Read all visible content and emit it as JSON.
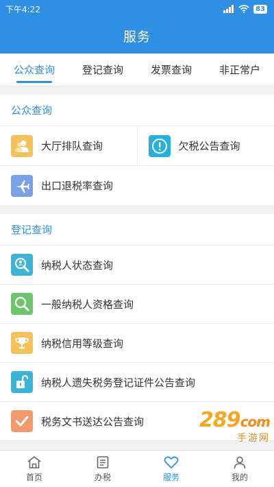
{
  "status": {
    "time": "下午4:22",
    "battery": "83"
  },
  "header": {
    "title": "服务"
  },
  "tabs": [
    {
      "label": "公众查询",
      "active": true
    },
    {
      "label": "登记查询",
      "active": false
    },
    {
      "label": "发票查询",
      "active": false
    },
    {
      "label": "非正常户",
      "active": false
    }
  ],
  "public_query": {
    "title": "公众查询",
    "items": [
      {
        "label": "大厅排队查询",
        "icon": "user-queue-icon",
        "color": "#f5c15a"
      },
      {
        "label": "欠税公告查询",
        "icon": "exclamation-icon",
        "color": "#27b1d9"
      },
      {
        "label": "出口退税率查询",
        "icon": "airplane-icon",
        "color": "#7aa0e6"
      }
    ]
  },
  "registration_query": {
    "title": "登记查询",
    "items": [
      {
        "label": "纳税人状态查询",
        "icon": "magnifier-person-icon",
        "color": "#3bb4d6"
      },
      {
        "label": "一般纳税人资格查询",
        "icon": "magnifier-icon",
        "color": "#6cc56a"
      },
      {
        "label": "纳税信用等级查询",
        "icon": "trophy-icon",
        "color": "#f5c15a"
      },
      {
        "label": "纳税人遗失税务登记证件公告查询",
        "icon": "unlock-icon",
        "color": "#3bb4d6"
      },
      {
        "label": "税务文书送达公告查询",
        "icon": "checkmark-icon",
        "color": "#f29a6b"
      }
    ]
  },
  "bottom_nav": [
    {
      "label": "首页",
      "icon": "home-icon",
      "active": false
    },
    {
      "label": "办税",
      "icon": "document-icon",
      "active": false
    },
    {
      "label": "服务",
      "icon": "heart-icon",
      "active": true
    },
    {
      "label": "我的",
      "icon": "profile-icon",
      "active": false
    }
  ],
  "watermark": {
    "logo": "289",
    "suffix": "com",
    "text": "手游网"
  },
  "colors": {
    "primary": "#2f8fe3",
    "background": "#f2f2f2"
  }
}
